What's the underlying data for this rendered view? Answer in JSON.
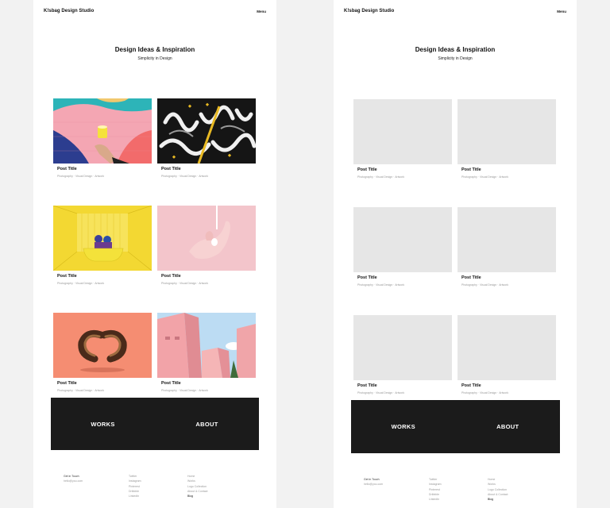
{
  "site": {
    "brand": "K!sbag Design Studio",
    "menu_label": "Menu"
  },
  "hero": {
    "title": "Design Ideas & Inspiration",
    "subtitle": "Simplicity in Design"
  },
  "posts": [
    {
      "title": "Post Title",
      "meta": "Photography · Visual Design · Artwork",
      "image": "pink-wall-hand-cup"
    },
    {
      "title": "Post Title",
      "meta": "Photography · Visual Design · Artwork",
      "image": "calligraphy-letters"
    },
    {
      "title": "Post Title",
      "meta": "Photography · Visual Design · Artwork",
      "image": "yellow-room-bathtub"
    },
    {
      "title": "Post Title",
      "meta": "Photography · Visual Design · Artwork",
      "image": "pink-hand"
    },
    {
      "title": "Post Title",
      "meta": "Photography · Visual Design · Artwork",
      "image": "coral-3d-letters"
    },
    {
      "title": "Post Title",
      "meta": "Photography · Visual Design · Artwork",
      "image": "pink-architecture"
    }
  ],
  "nav": {
    "works": "WORKS",
    "about": "ABOUT"
  },
  "footer": {
    "contact": {
      "heading": "Get in Touch",
      "email": "hello@you.com"
    },
    "social": [
      "Twitter",
      "Instagram",
      "Pinterest",
      "Dribbble",
      "LinkedIn"
    ],
    "links": [
      "Home",
      "Works",
      "Logo Collection",
      "About & Contact",
      "Blog"
    ]
  },
  "colors": {
    "page_bg": "#f2f2f2",
    "panel_bg": "#ffffff",
    "placeholder": "#e6e6e6",
    "nav_band": "#1b1b1b"
  }
}
